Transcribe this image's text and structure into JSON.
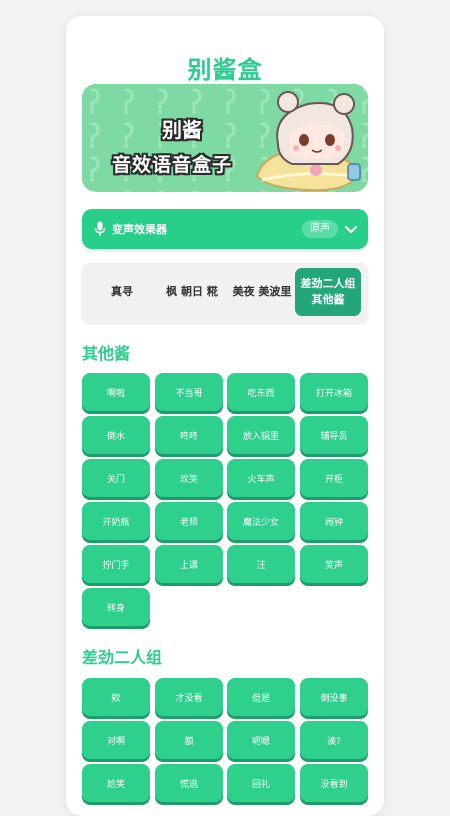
{
  "app": {
    "title": "别酱盒"
  },
  "banner": {
    "line1": "别酱",
    "line2": "音效语音盒子"
  },
  "voice_changer": {
    "label": "变声效果器",
    "selected": "原声"
  },
  "tabs": [
    "真寻",
    "枫 朝日 糀",
    "美夜 美波里",
    "差劲二人组 其他酱"
  ],
  "sections": [
    {
      "title": "其他酱",
      "buttons": [
        "啊啦",
        "不当哥",
        "吃东西",
        "打开冰箱",
        "倒水",
        "咚咚",
        "放入锅里",
        "辅导员",
        "关门",
        "欢笑",
        "火车声",
        "开柜",
        "开奶瓶",
        "老师",
        "魔法少女",
        "闹钟",
        "拧门手",
        "上课",
        "汪",
        "笑声",
        "转身"
      ]
    },
    {
      "title": "差劲二人组",
      "buttons": [
        "欸",
        "才没看",
        "但是",
        "倒没事",
        "对啊",
        "额",
        "呃嗯",
        "诶?",
        "尬笑",
        "慌逃",
        "回礼",
        "没看到"
      ]
    }
  ],
  "colors": {
    "accent": "#2dcc8f",
    "button": "#2fcf8d",
    "active_tab": "#23a67a"
  }
}
